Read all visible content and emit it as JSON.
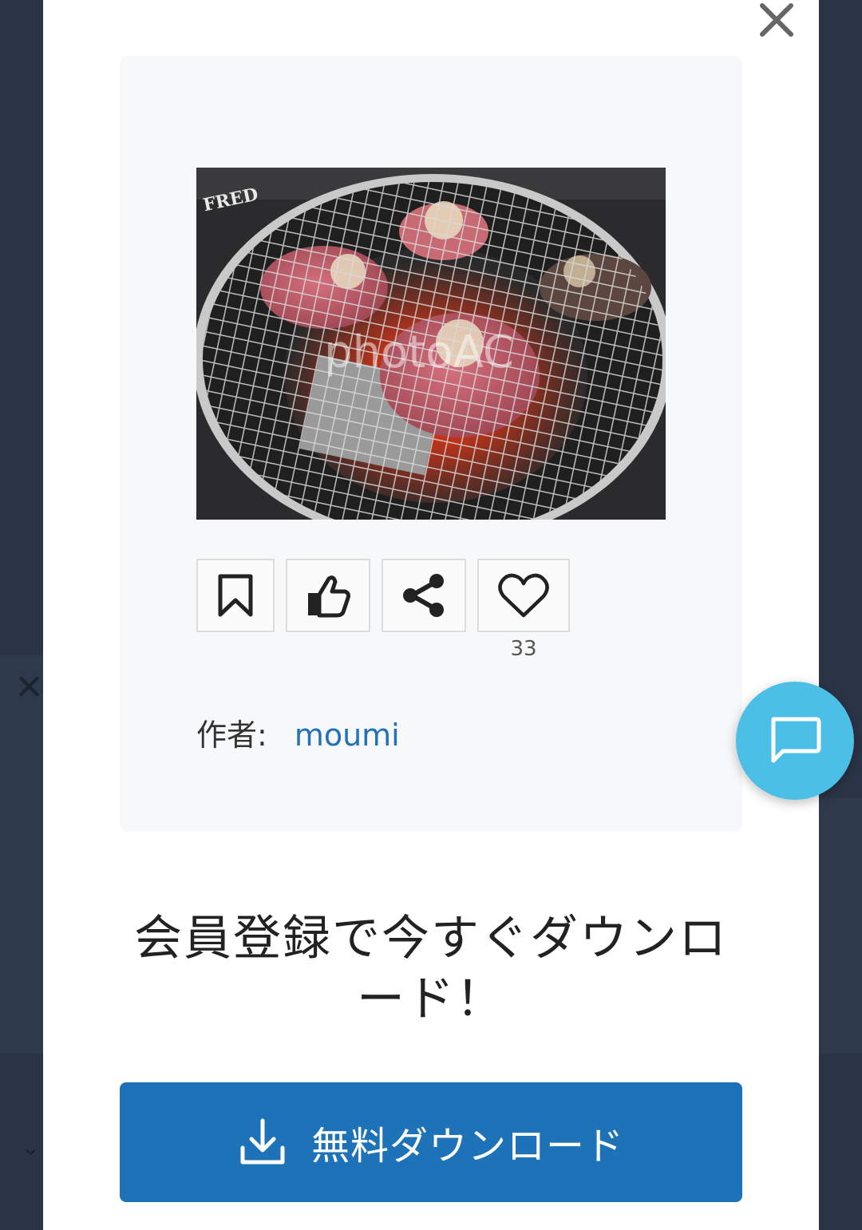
{
  "modal": {
    "close_icon": "close-icon",
    "photo_alt": "焼肉",
    "watermark": "photoAC",
    "photo_text": "FRED",
    "actions": [
      {
        "name": "bookmark",
        "icon": "bookmark-icon"
      },
      {
        "name": "thumbs-up",
        "icon": "thumbs-up-icon"
      },
      {
        "name": "share",
        "icon": "share-icon"
      },
      {
        "name": "favorite",
        "icon": "heart-icon"
      }
    ],
    "like_count": "33",
    "author_label": "作者:",
    "author_name": "moumi",
    "headline": "会員登録で今すぐダウンロード！",
    "download_button": "無料ダウンロード",
    "download_icon": "download-icon"
  },
  "chat": {
    "icon": "chat-icon"
  },
  "colors": {
    "accent_blue": "#1e72b8",
    "link_blue": "#2471b5",
    "chat_blue": "#4bbfe6",
    "backdrop": "#2b3446"
  }
}
